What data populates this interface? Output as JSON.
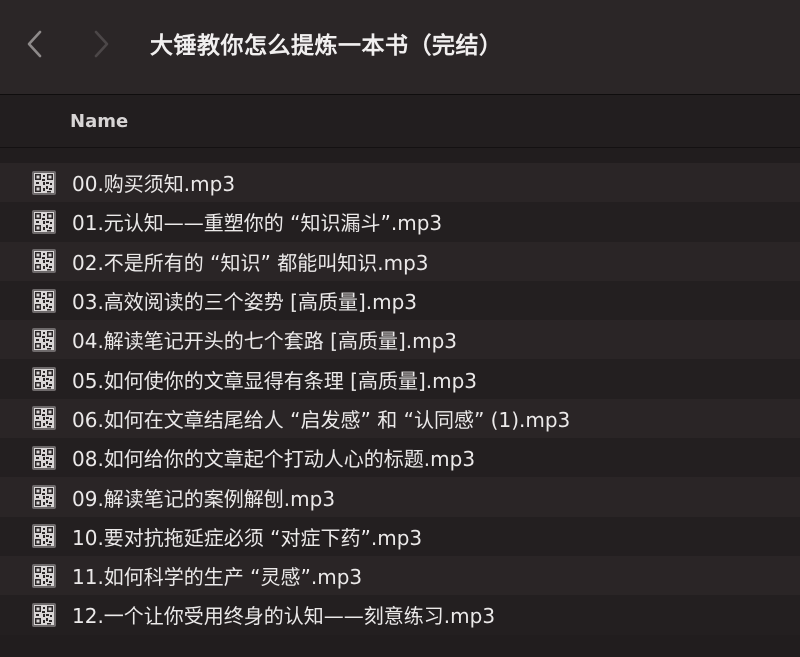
{
  "window": {
    "title": "大锤教你怎么提炼一本书（完结）"
  },
  "toolbar": {
    "back_icon": "chevron-left-icon",
    "forward_icon": "chevron-right-icon"
  },
  "columns": {
    "name_header": "Name"
  },
  "files": [
    {
      "name": "00.购买须知.mp3",
      "icon": "audio-file-icon"
    },
    {
      "name": "01.元认知——重塑你的 “知识漏斗”.mp3",
      "icon": "audio-file-icon"
    },
    {
      "name": "02.不是所有的 “知识” 都能叫知识.mp3",
      "icon": "audio-file-icon"
    },
    {
      "name": "03.高效阅读的三个姿势 [高质量].mp3",
      "icon": "audio-file-icon"
    },
    {
      "name": "04.解读笔记开头的七个套路 [高质量].mp3",
      "icon": "audio-file-icon"
    },
    {
      "name": "05.如何使你的文章显得有条理 [高质量].mp3",
      "icon": "audio-file-icon"
    },
    {
      "name": "06.如何在文章结尾给人 “启发感” 和 “认同感” (1).mp3",
      "icon": "audio-file-icon"
    },
    {
      "name": "08.如何给你的文章起个打动人心的标题.mp3",
      "icon": "audio-file-icon"
    },
    {
      "name": "09.解读笔记的案例解刨.mp3",
      "icon": "audio-file-icon"
    },
    {
      "name": "10.要对抗拖延症必须 “对症下药”.mp3",
      "icon": "audio-file-icon"
    },
    {
      "name": "11.如何科学的生产 “灵感”.mp3",
      "icon": "audio-file-icon"
    },
    {
      "name": "12.一个让你受用终身的认知——刻意练习.mp3",
      "icon": "audio-file-icon"
    }
  ],
  "colors": {
    "background": "#211d1e",
    "titlebar": "#2b2627",
    "row_alt": "#2a2526"
  }
}
